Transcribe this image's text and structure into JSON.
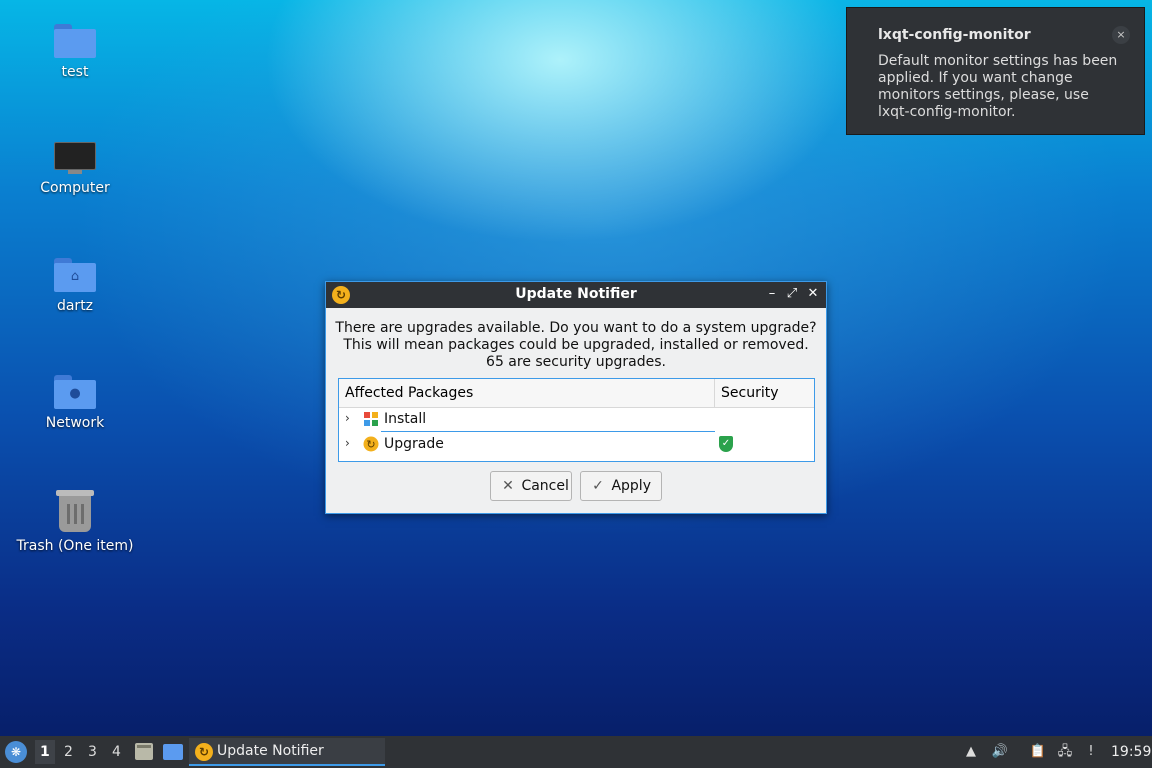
{
  "desktop": {
    "icons": [
      {
        "label": "test",
        "icon": "folder-icon"
      },
      {
        "label": "Computer",
        "icon": "computer-icon"
      },
      {
        "label": "dartz",
        "icon": "home-folder-icon"
      },
      {
        "label": "Network",
        "icon": "network-folder-icon"
      },
      {
        "label": "Trash (One item)",
        "icon": "trash-icon"
      }
    ]
  },
  "notification": {
    "title": "lxqt-config-monitor",
    "body": "Default monitor settings has been applied. If you want change monitors settings, please, use lxqt-config-monitor.",
    "close_glyph": "×"
  },
  "dialog": {
    "title": "Update Notifier",
    "message_line1": "There are upgrades available. Do you want to do a system upgrade?",
    "message_line2": "This will mean packages could be upgraded, installed or removed.",
    "message_line3": "65 are security upgrades.",
    "columns": [
      "Affected Packages",
      "Security"
    ],
    "rows": [
      {
        "label": "Install",
        "icon": "install-icon",
        "security": false
      },
      {
        "label": "Upgrade",
        "icon": "upgrade-icon",
        "security": true
      }
    ],
    "cancel_label": "Cancel",
    "apply_label": "Apply"
  },
  "taskbar": {
    "desktops": [
      "1",
      "2",
      "3",
      "4"
    ],
    "active_desktop": "1",
    "task_label": "Update Notifier",
    "clock": "19:59"
  },
  "colors": {
    "accent": "#3d9ae8",
    "panel": "#2f3236",
    "shield": "#2ba24c"
  }
}
